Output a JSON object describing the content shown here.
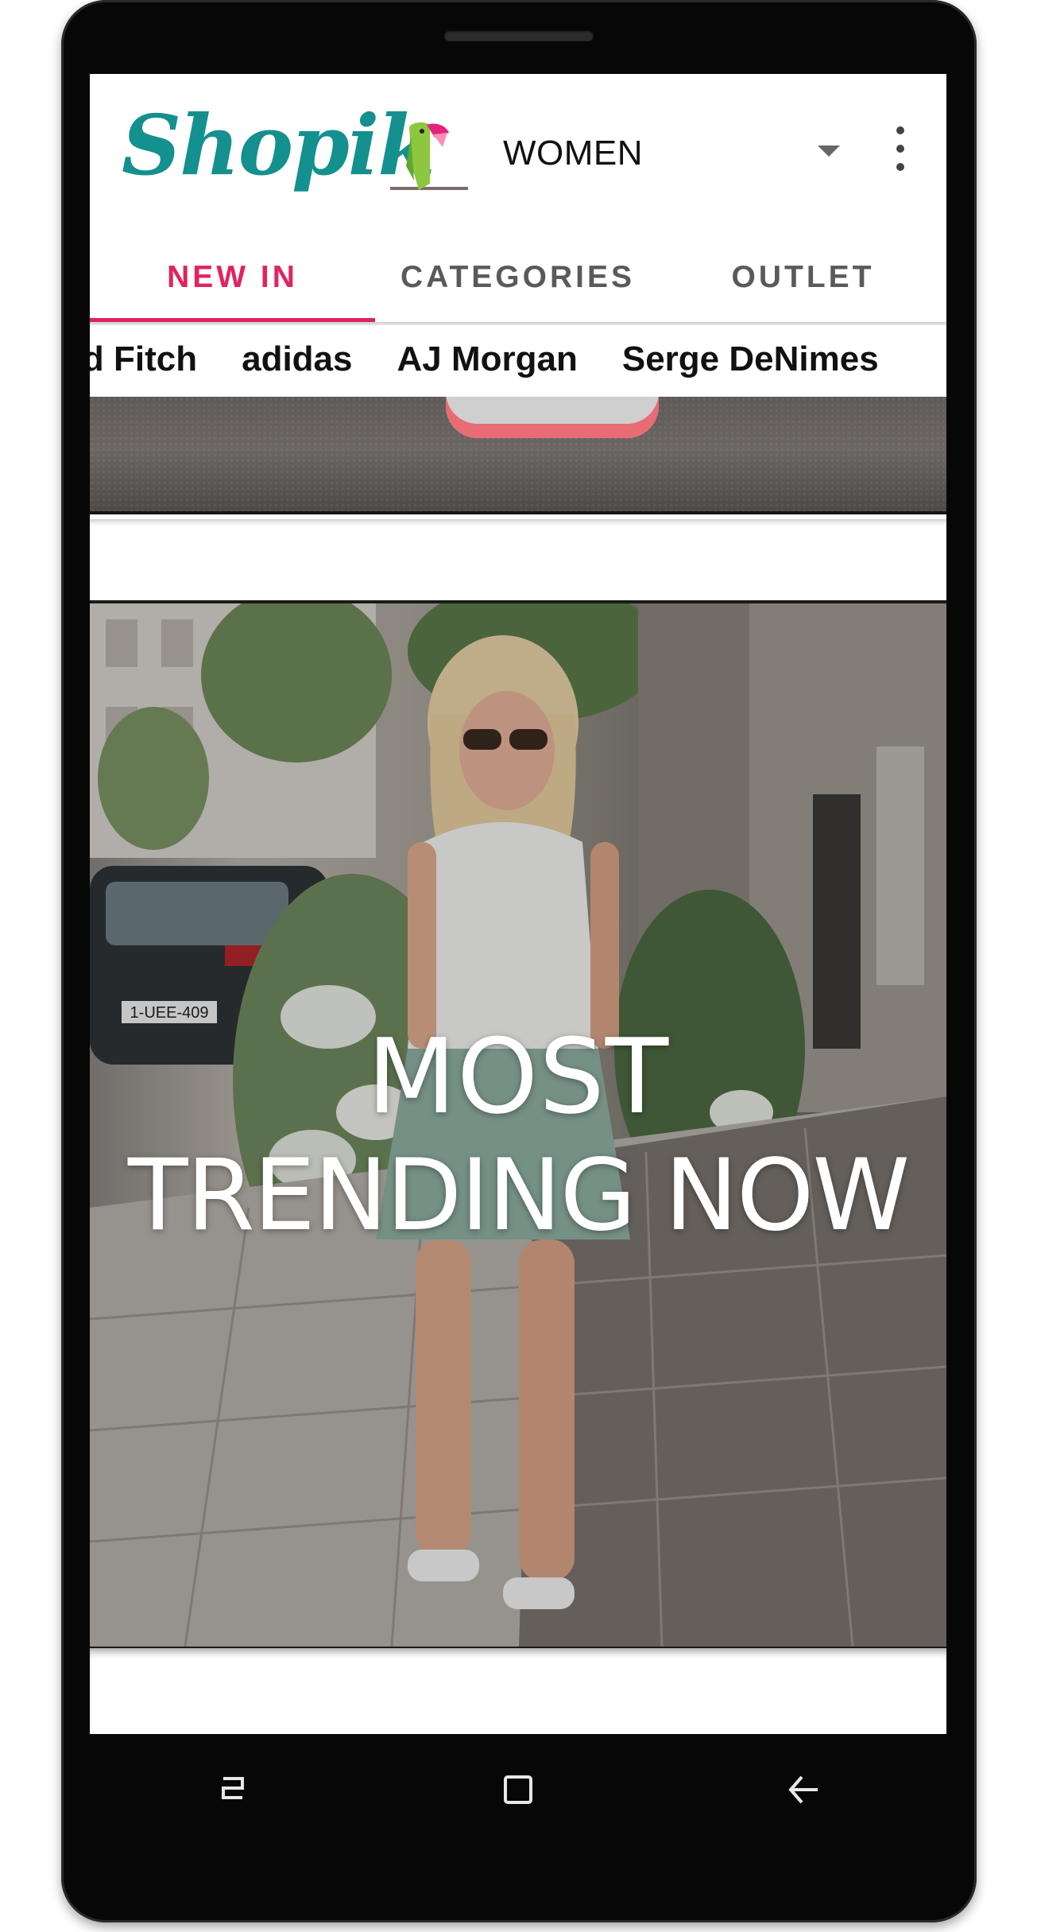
{
  "app": {
    "logo_text": "Shopik",
    "gender_selector": {
      "value": "WOMEN"
    },
    "colors": {
      "brand_teal": "#14908e",
      "accent_pink": "#e0245e"
    }
  },
  "tabs": [
    {
      "label": "NEW IN",
      "active": true
    },
    {
      "label": "CATEGORIES",
      "active": false
    },
    {
      "label": "OUTLET",
      "active": false
    }
  ],
  "brands": [
    "nd Fitch",
    "adidas",
    "AJ Morgan",
    "Serge DeNimes"
  ],
  "banner": {
    "headline_line1": "MOST",
    "headline_line2": "TRENDING NOW",
    "license_plate": "1-UEE-409"
  },
  "icons": {
    "menu": "more-vert-icon",
    "dropdown": "arrow-drop-down-icon",
    "nav": [
      "recents-icon",
      "home-icon",
      "back-icon"
    ]
  }
}
